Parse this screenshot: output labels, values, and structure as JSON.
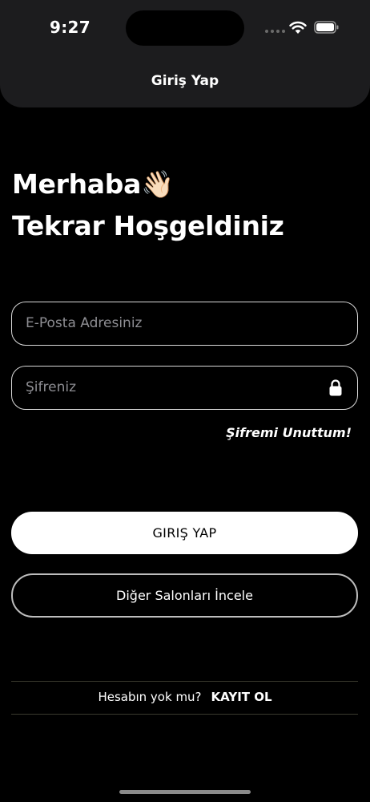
{
  "status_bar": {
    "time": "9:27"
  },
  "header": {
    "title": "Giriş Yap"
  },
  "greeting": {
    "line1": "Merhaba👋🏻",
    "line2": "Tekrar Hoşgeldiniz"
  },
  "form": {
    "email_placeholder": "E-Posta Adresiniz",
    "email_value": "",
    "password_placeholder": "Şifreniz",
    "password_value": "",
    "password_icon": "lock-icon",
    "forgot_label": "Şifremi Unuttum!"
  },
  "actions": {
    "login_label": "GIRIŞ YAP",
    "explore_label": "Diğer Salonları İncele"
  },
  "footer": {
    "question": "Hesabın yok mu?",
    "register_label": "KAYIT OL"
  },
  "colors": {
    "background": "#000000",
    "header_bg": "#1c1c1e",
    "primary_button_bg": "#ffffff",
    "primary_button_text": "#000000"
  }
}
